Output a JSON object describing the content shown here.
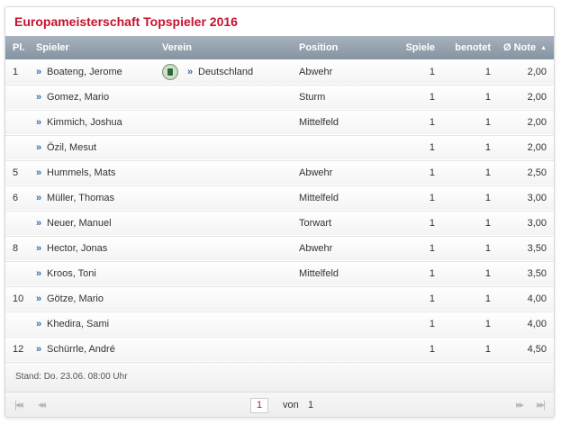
{
  "title": "Europameisterschaft Topspieler 2016",
  "columns": {
    "pl": "Pl.",
    "spieler": "Spieler",
    "verein": "Verein",
    "position": "Position",
    "spiele": "Spiele",
    "benotet": "benotet",
    "note": "Ø Note",
    "sort_icon": "sort-ascending-icon"
  },
  "rows": [
    {
      "pl": "1",
      "name": "Boateng, Jerome",
      "verein": "Deutschland",
      "position": "Abwehr",
      "spiele": "1",
      "benotet": "1",
      "note": "2,00"
    },
    {
      "pl": "",
      "name": "Gomez, Mario",
      "verein": "",
      "position": "Sturm",
      "spiele": "1",
      "benotet": "1",
      "note": "2,00"
    },
    {
      "pl": "",
      "name": "Kimmich, Joshua",
      "verein": "",
      "position": "Mittelfeld",
      "spiele": "1",
      "benotet": "1",
      "note": "2,00"
    },
    {
      "pl": "",
      "name": "Özil, Mesut",
      "verein": "",
      "position": "",
      "spiele": "1",
      "benotet": "1",
      "note": "2,00"
    },
    {
      "pl": "5",
      "name": "Hummels, Mats",
      "verein": "",
      "position": "Abwehr",
      "spiele": "1",
      "benotet": "1",
      "note": "2,50"
    },
    {
      "pl": "6",
      "name": "Müller, Thomas",
      "verein": "",
      "position": "Mittelfeld",
      "spiele": "1",
      "benotet": "1",
      "note": "3,00"
    },
    {
      "pl": "",
      "name": "Neuer, Manuel",
      "verein": "",
      "position": "Torwart",
      "spiele": "1",
      "benotet": "1",
      "note": "3,00"
    },
    {
      "pl": "8",
      "name": "Hector, Jonas",
      "verein": "",
      "position": "Abwehr",
      "spiele": "1",
      "benotet": "1",
      "note": "3,50"
    },
    {
      "pl": "",
      "name": "Kroos, Toni",
      "verein": "",
      "position": "Mittelfeld",
      "spiele": "1",
      "benotet": "1",
      "note": "3,50"
    },
    {
      "pl": "10",
      "name": "Götze, Mario",
      "verein": "",
      "position": "",
      "spiele": "1",
      "benotet": "1",
      "note": "4,00"
    },
    {
      "pl": "",
      "name": "Khedira, Sami",
      "verein": "",
      "position": "",
      "spiele": "1",
      "benotet": "1",
      "note": "4,00"
    },
    {
      "pl": "12",
      "name": "Schürrle, André",
      "verein": "",
      "position": "",
      "spiele": "1",
      "benotet": "1",
      "note": "4,50"
    }
  ],
  "status": "Stand: Do. 23.06. 08:00 Uhr",
  "pager": {
    "current_page": "1",
    "of_label": "von",
    "total_pages": "1"
  },
  "colors": {
    "accent": "#c8102e",
    "header": "#8d9aa8",
    "link_arrow": "#3a68b0"
  }
}
